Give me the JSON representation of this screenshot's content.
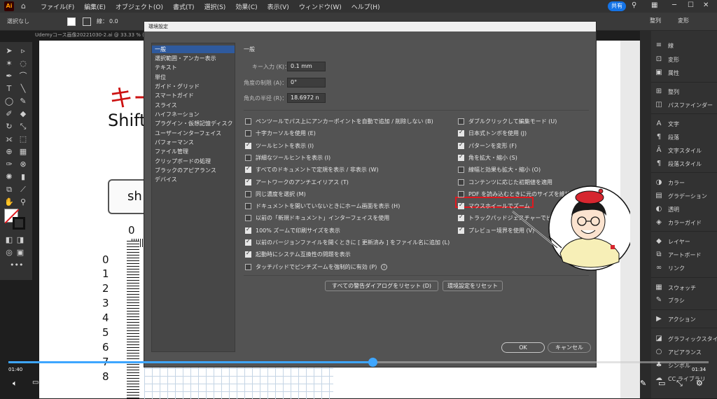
{
  "menubar": {
    "items": [
      "ファイル(F)",
      "編集(E)",
      "オブジェクト(O)",
      "書式(T)",
      "選択(S)",
      "効果(C)",
      "表示(V)",
      "ウィンドウ(W)",
      "ヘルプ(H)"
    ],
    "share": "共有"
  },
  "ctrlbar": {
    "selection": "選択なし",
    "stroke_label": "線：",
    "stroke_value": "0.0",
    "right1": "整列",
    "right2": "変形"
  },
  "doctab": "Udemyコース画像20221030-2.ai @ 33.33 % (",
  "canvas": {
    "red_text": "キー",
    "shift_text": "Shift",
    "key_label": "sh",
    "zero_top": "0",
    "ruler_numbers": [
      "0",
      "1",
      "2",
      "3",
      "4",
      "5",
      "6",
      "7",
      "8"
    ]
  },
  "right_panel": {
    "items": [
      {
        "icon": "stroke-icon",
        "label": "線"
      },
      {
        "icon": "transform-icon",
        "label": "変形"
      },
      {
        "icon": "attributes-icon",
        "label": "属性"
      },
      {
        "icon": "align-icon",
        "label": "整列"
      },
      {
        "icon": "pathfinder-icon",
        "label": "パスファインダー"
      },
      {
        "icon": "character-icon",
        "label": "文字"
      },
      {
        "icon": "paragraph-icon",
        "label": "段落"
      },
      {
        "icon": "char-style-icon",
        "label": "文字スタイル"
      },
      {
        "icon": "para-style-icon",
        "label": "段落スタイル"
      },
      {
        "icon": "color-icon",
        "label": "カラー"
      },
      {
        "icon": "gradient-icon",
        "label": "グラデーション"
      },
      {
        "icon": "transparency-icon",
        "label": "透明"
      },
      {
        "icon": "color-guide-icon",
        "label": "カラーガイド"
      },
      {
        "icon": "layers-icon",
        "label": "レイヤー"
      },
      {
        "icon": "artboard-icon",
        "label": "アートボード"
      },
      {
        "icon": "links-icon",
        "label": "リンク"
      },
      {
        "icon": "swatches-icon",
        "label": "スウォッチ"
      },
      {
        "icon": "brushes-icon",
        "label": "ブラシ"
      },
      {
        "icon": "actions-icon",
        "label": "アクション"
      },
      {
        "icon": "graphic-styles-icon",
        "label": "グラフィックスタイル"
      },
      {
        "icon": "appearance-icon",
        "label": "アピアランス"
      },
      {
        "icon": "symbols-icon",
        "label": "シンボル"
      },
      {
        "icon": "cc-libraries-icon",
        "label": "CC ライブラリ"
      }
    ]
  },
  "dialog": {
    "title": "環境設定",
    "categories": [
      "一般",
      "選択範囲・アンカー表示",
      "テキスト",
      "単位",
      "ガイド・グリッド",
      "スマートガイド",
      "スライス",
      "ハイフネーション",
      "プラグイン・仮想記憶ディスク",
      "ユーザーインターフェイス",
      "パフォーマンス",
      "ファイル管理",
      "クリップボードの処理",
      "ブラックのアピアランス",
      "デバイス"
    ],
    "section": "一般",
    "fields": [
      {
        "label": "キー入力 (K)：",
        "value": "0.1 mm"
      },
      {
        "label": "角度の制限 (A)：",
        "value": "0°"
      },
      {
        "label": "角丸の半径 (R)：",
        "value": "18.6972 n"
      }
    ],
    "left_checks": [
      {
        "label": "ペンツールでパス上にアンカーポイントを自動で追加 / 削除しない (B)",
        "on": false
      },
      {
        "label": "十字カーソルを使用 (E)",
        "on": false
      },
      {
        "label": "ツールヒントを表示 (I)",
        "on": true
      },
      {
        "label": "詳細なツールヒントを表示 (I)",
        "on": false
      },
      {
        "label": "すべてのドキュメントで定規を表示 / 非表示 (W)",
        "on": true
      },
      {
        "label": "アートワークのアンチエイリアス (T)",
        "on": true
      },
      {
        "label": "同じ濃度を選択 (M)",
        "on": false
      },
      {
        "label": "ドキュメントを開いていないときにホーム画面を表示 (H)",
        "on": false
      },
      {
        "label": "以前の「新規ドキュメント」インターフェイスを使用",
        "on": false
      },
      {
        "label": "100% ズームで印刷サイズを表示",
        "on": true
      },
      {
        "label": "以前のバージョンファイルを開くときに [ 更新済み ] をファイル名に追加 (L)",
        "on": true
      },
      {
        "label": "起動時にシステム互換性の問題を表示",
        "on": true
      },
      {
        "label": "タッチパッドでピンチズームを強制的に有効 (P)",
        "on": false
      }
    ],
    "right_checks": [
      {
        "label": "ダブルクリックして編集モード (U)",
        "on": false
      },
      {
        "label": "日本式トンボを使用 (J)",
        "on": true
      },
      {
        "label": "パターンを変形 (F)",
        "on": true
      },
      {
        "label": "角を拡大・縮小 (S)",
        "on": true
      },
      {
        "label": "線幅と効果も拡大・縮小 (O)",
        "on": false
      },
      {
        "label": "コンテンツに応じた初期値を適用",
        "on": false
      },
      {
        "label": "PDF を読み込むときに元のサイズを維持",
        "on": false
      },
      {
        "label": "マウスホイールでズーム",
        "on": true
      },
      {
        "label": "トラックパッドジェスチャーでビューを回",
        "on": true
      },
      {
        "label": "プレビュー境界を使用 (V)",
        "on": true
      }
    ],
    "reset_warnings": "すべての警告ダイアログをリセット (D)",
    "reset_prefs": "環境設定をリセット",
    "ok": "OK",
    "cancel": "キャンセル"
  },
  "video": {
    "elapsed": "01:40",
    "remaining": "01:34",
    "progress": 0.52
  }
}
